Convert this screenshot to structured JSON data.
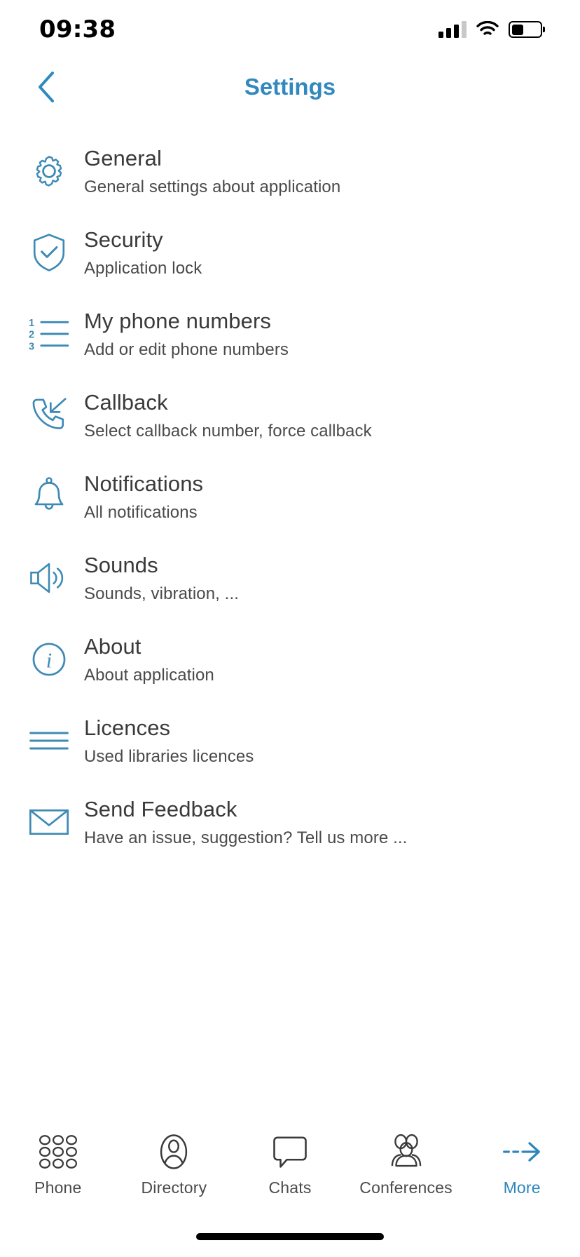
{
  "status_bar": {
    "time": "09:38",
    "signal_bars_total": 4,
    "signal_bars_filled": 3,
    "wifi_icon": "wifi-icon",
    "battery_level_percent": 42
  },
  "nav": {
    "back_icon": "chevron-left-icon",
    "title": "Settings",
    "title_color": "#3189bf"
  },
  "theme": {
    "accent": "#3189bf",
    "icon_stroke": "#3d8ab5",
    "title_text": "#3a3a3a",
    "sub_text": "#4a4a4a"
  },
  "settings": {
    "items": [
      {
        "icon": "gear-icon",
        "title": "General",
        "subtitle": "General settings about application"
      },
      {
        "icon": "shield-check-icon",
        "title": "Security",
        "subtitle": "Application lock"
      },
      {
        "icon": "numbered-list-icon",
        "title": "My phone numbers",
        "subtitle": "Add or edit phone numbers"
      },
      {
        "icon": "phone-callback-icon",
        "title": "Callback",
        "subtitle": "Select callback number, force callback"
      },
      {
        "icon": "bell-icon",
        "title": "Notifications",
        "subtitle": "All notifications"
      },
      {
        "icon": "speaker-icon",
        "title": "Sounds",
        "subtitle": "Sounds, vibration, ..."
      },
      {
        "icon": "info-circle-icon",
        "title": "About",
        "subtitle": "About application"
      },
      {
        "icon": "lines-icon",
        "title": "Licences",
        "subtitle": "Used libraries licences"
      },
      {
        "icon": "envelope-icon",
        "title": "Send Feedback",
        "subtitle": "Have an issue, suggestion? Tell us more ..."
      }
    ]
  },
  "tab_bar": {
    "items": [
      {
        "icon": "dialpad-icon",
        "label": "Phone",
        "active": false
      },
      {
        "icon": "person-icon",
        "label": "Directory",
        "active": false
      },
      {
        "icon": "chat-bubble-icon",
        "label": "Chats",
        "active": false
      },
      {
        "icon": "group-icon",
        "label": "Conferences",
        "active": false
      },
      {
        "icon": "arrow-right-icon",
        "label": "More",
        "active": true
      }
    ]
  }
}
